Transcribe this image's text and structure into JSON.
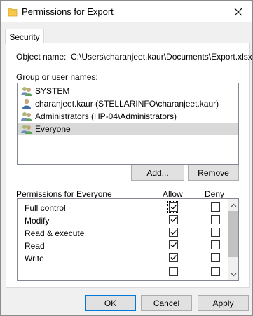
{
  "window": {
    "title": "Permissions for Export"
  },
  "tabs": [
    {
      "label": "Security"
    }
  ],
  "object": {
    "label": "Object name:",
    "value": "C:\\Users\\charanjeet.kaur\\Documents\\Export.xlsx"
  },
  "groups": {
    "label": "Group or user names:",
    "items": [
      {
        "label": "SYSTEM",
        "icon": "users-icon",
        "selected": false
      },
      {
        "label": "charanjeet.kaur (STELLARINFO\\charanjeet.kaur)",
        "icon": "user-icon",
        "selected": false
      },
      {
        "label": "Administrators (HP-04\\Administrators)",
        "icon": "users-icon",
        "selected": false
      },
      {
        "label": "Everyone",
        "icon": "users-icon",
        "selected": true
      }
    ],
    "add_label": "Add...",
    "remove_label": "Remove"
  },
  "permissions": {
    "header": "Permissions for Everyone",
    "allow_header": "Allow",
    "deny_header": "Deny",
    "rows": [
      {
        "name": "Full control",
        "allow": true,
        "deny": false
      },
      {
        "name": "Modify",
        "allow": true,
        "deny": false
      },
      {
        "name": "Read & execute",
        "allow": true,
        "deny": false
      },
      {
        "name": "Read",
        "allow": true,
        "deny": false
      },
      {
        "name": "Write",
        "allow": true,
        "deny": false
      }
    ]
  },
  "footer": {
    "ok_label": "OK",
    "cancel_label": "Cancel",
    "apply_label": "Apply"
  },
  "colors": {
    "accent": "#0078d7",
    "selection": "#d9d9d9",
    "folder": "#f7c84b"
  }
}
